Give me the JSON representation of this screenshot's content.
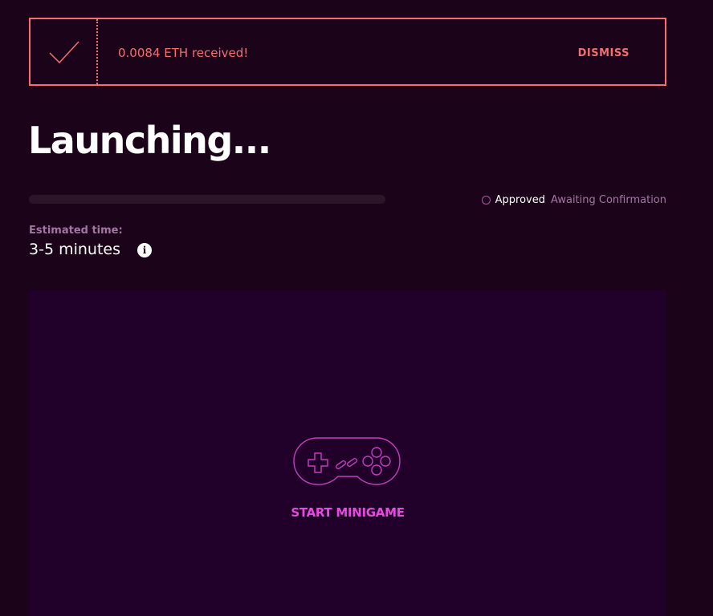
{
  "notice": {
    "message": "0.0084 ETH received!",
    "dismiss_label": "DISMISS",
    "icon": "checkmark-icon"
  },
  "title": "Launching...",
  "progress": {
    "value_percent": 0,
    "status_approved": "Approved",
    "status_awaiting": "Awaiting Confirmation"
  },
  "estimate": {
    "label": "Estimated time:",
    "value": "3-5 minutes",
    "info_icon_glyph": "i"
  },
  "minigame": {
    "icon": "gamepad-icon",
    "start_label": "START MINIGAME"
  },
  "colors": {
    "background": "#1b0419",
    "accent_coral": "#f46d6f",
    "accent_magenta": "#e54bdf",
    "muted_purple": "#a276a3",
    "panel": "#210029"
  }
}
